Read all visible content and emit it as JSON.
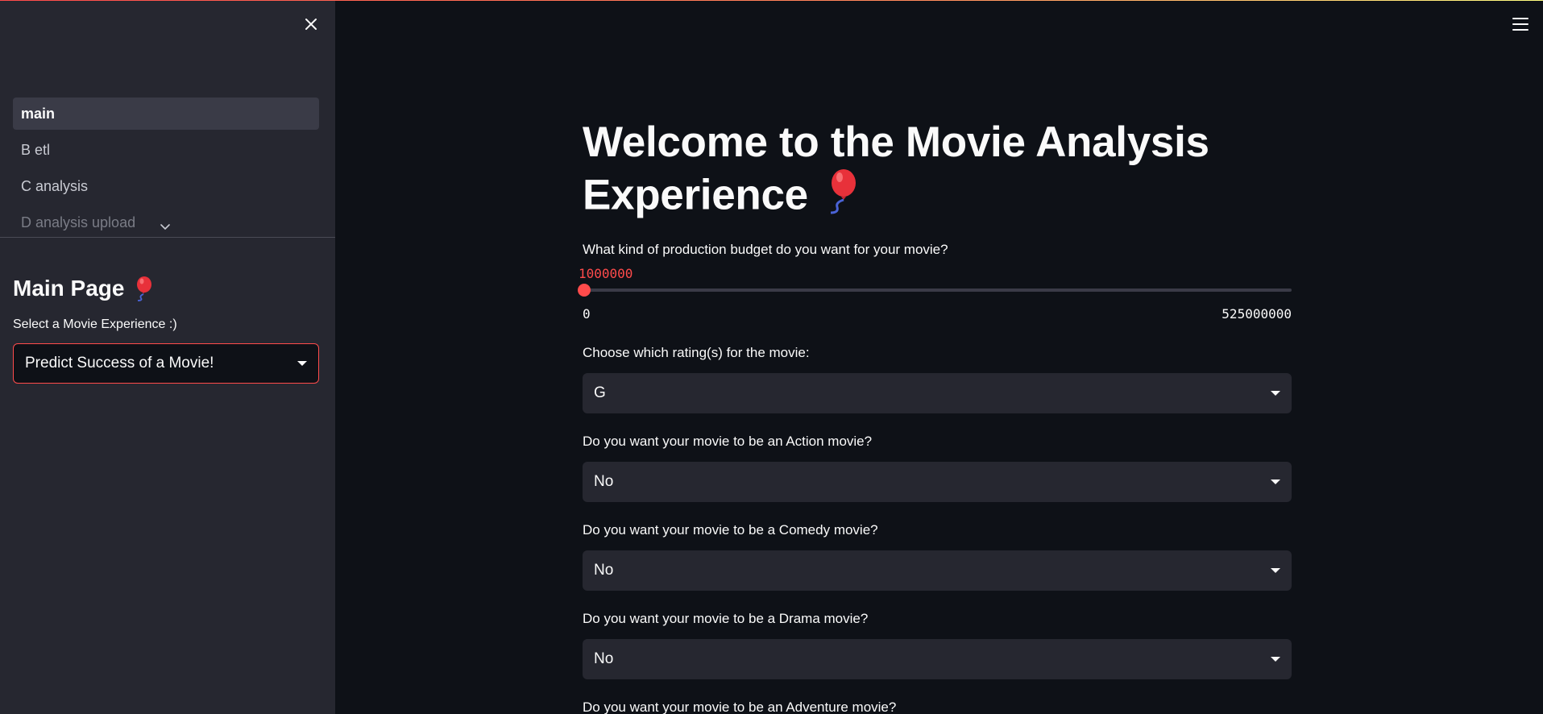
{
  "sidebar": {
    "nav_items": [
      {
        "label": "main"
      },
      {
        "label": "B etl"
      },
      {
        "label": "C analysis"
      },
      {
        "label": "D analysis upload"
      }
    ],
    "title": "Main Page",
    "select_label": "Select a Movie Experience :)",
    "select_value": "Predict Success of a Movie!"
  },
  "main": {
    "title_line1": "Welcome to the Movie Analysis",
    "title_line2": "Experience",
    "budget": {
      "label": "What kind of production budget do you want for your movie?",
      "value": "1000000",
      "min": "0",
      "max": "525000000",
      "fraction": 0.0019
    },
    "rating": {
      "label": "Choose which rating(s) for the movie:",
      "value": "G"
    },
    "action": {
      "label": "Do you want your movie to be an Action movie?",
      "value": "No"
    },
    "comedy": {
      "label": "Do you want your movie to be a Comedy movie?",
      "value": "No"
    },
    "drama": {
      "label": "Do you want your movie to be a Drama movie?",
      "value": "No"
    },
    "adventure": {
      "label": "Do you want your movie to be an Adventure movie?"
    }
  },
  "icons": {
    "close": "close-icon",
    "menu": "hamburger-menu-icon",
    "balloon": "balloon-icon",
    "chevron": "chevron-down-icon",
    "caret": "caret-down-icon"
  },
  "colors": {
    "accent": "#ff4b4b",
    "background": "#0e1117",
    "sidebar": "#262730"
  }
}
